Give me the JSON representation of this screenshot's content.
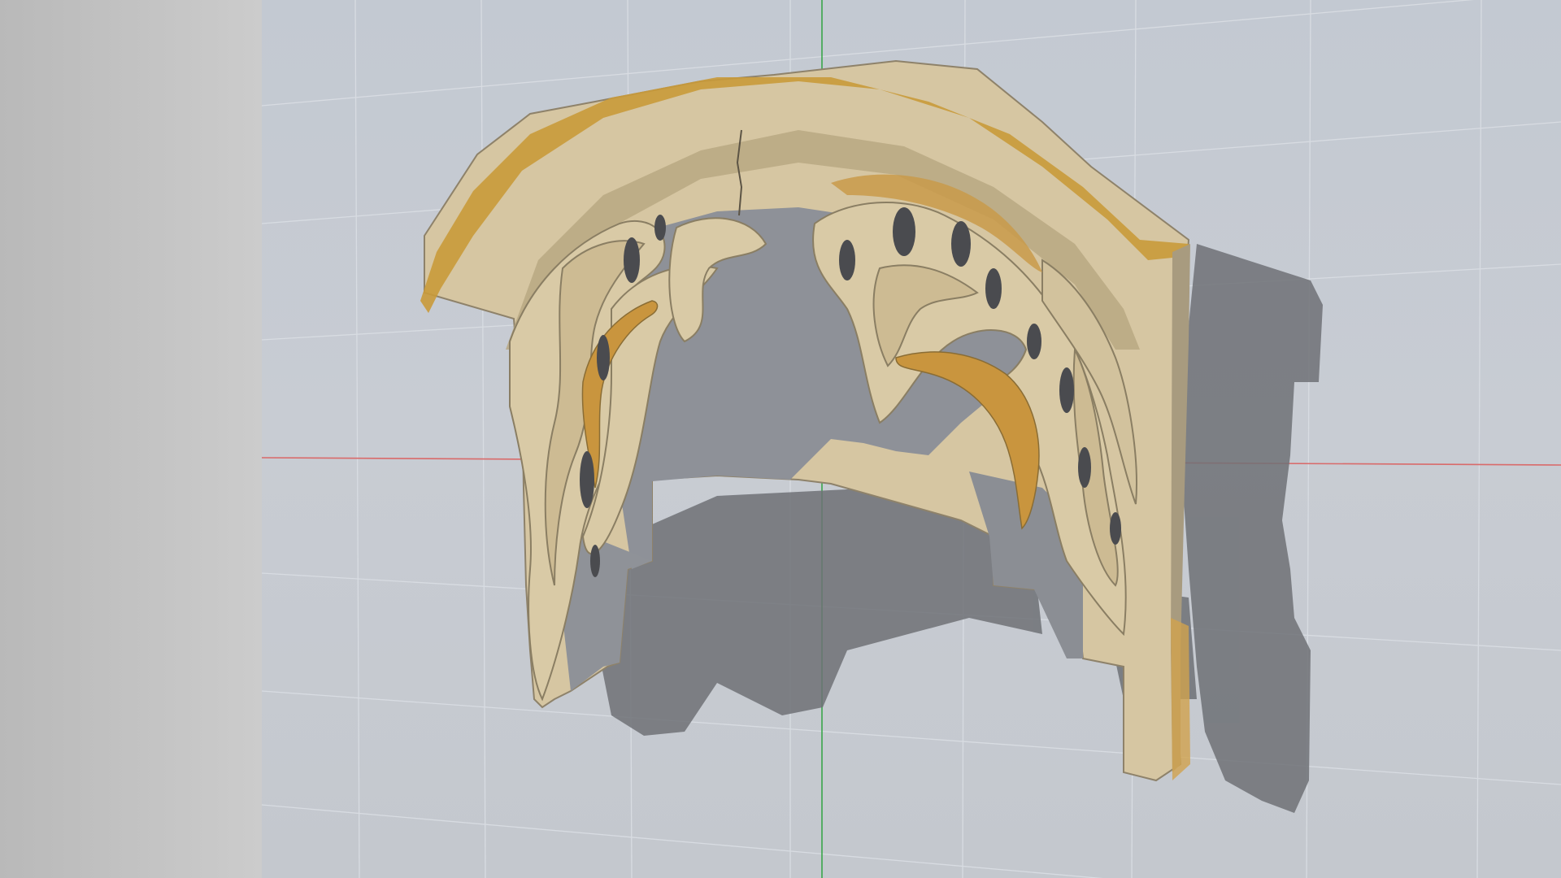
{
  "scene": {
    "model": "carved-rococo-arch-fragment",
    "colors": {
      "side_panel": "#c0c0c0",
      "viewport_background": "#c6cad1",
      "grid_line": "#d7dbe1",
      "x_axis": "#d96a6a",
      "y_axis": "#3aa64a",
      "stone_light": "#d8c9a6",
      "stone_mid": "#bfae86",
      "ochre_trim": "#c99a3a",
      "cavity_grey": "#8c8f96",
      "shadow": "#6f7277"
    }
  }
}
